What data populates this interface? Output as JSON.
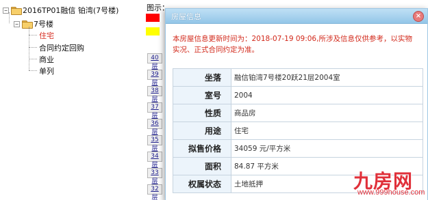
{
  "tree": {
    "root": "2016TP01融信 铂湾(7号楼)",
    "building": "7号楼",
    "items": [
      "住宅",
      "合同约定回购",
      "商业",
      "单列"
    ]
  },
  "legend": {
    "label": "图示：",
    "swatches": [
      {
        "color": "#ff0000"
      },
      {
        "color": "#ffff00"
      }
    ]
  },
  "floors": [
    "40层",
    "39层",
    "38层",
    "37层",
    "36层",
    "35层",
    "34层",
    "33层",
    "32层"
  ],
  "modal": {
    "title": "房屋信息",
    "close": "×",
    "notice": "本房屋信息更新时间为：2018-07-19 09:06,所涉及信息仅供参考，以实物实况、正式合同约定为准。",
    "rows": [
      {
        "label": "坐落",
        "value": "融信铂湾7号楼20跃21层2004室"
      },
      {
        "label": "室号",
        "value": "2004"
      },
      {
        "label": "性质",
        "value": "商品房"
      },
      {
        "label": "用途",
        "value": "住宅"
      },
      {
        "label": "拟售价格",
        "value": "34059 元/平方米"
      },
      {
        "label": "面积",
        "value": "84.87 平方米"
      },
      {
        "label": "权属状态",
        "value": "土地抵押"
      }
    ]
  },
  "watermark": {
    "logo": "九房网",
    "url": "www.999house.com"
  }
}
